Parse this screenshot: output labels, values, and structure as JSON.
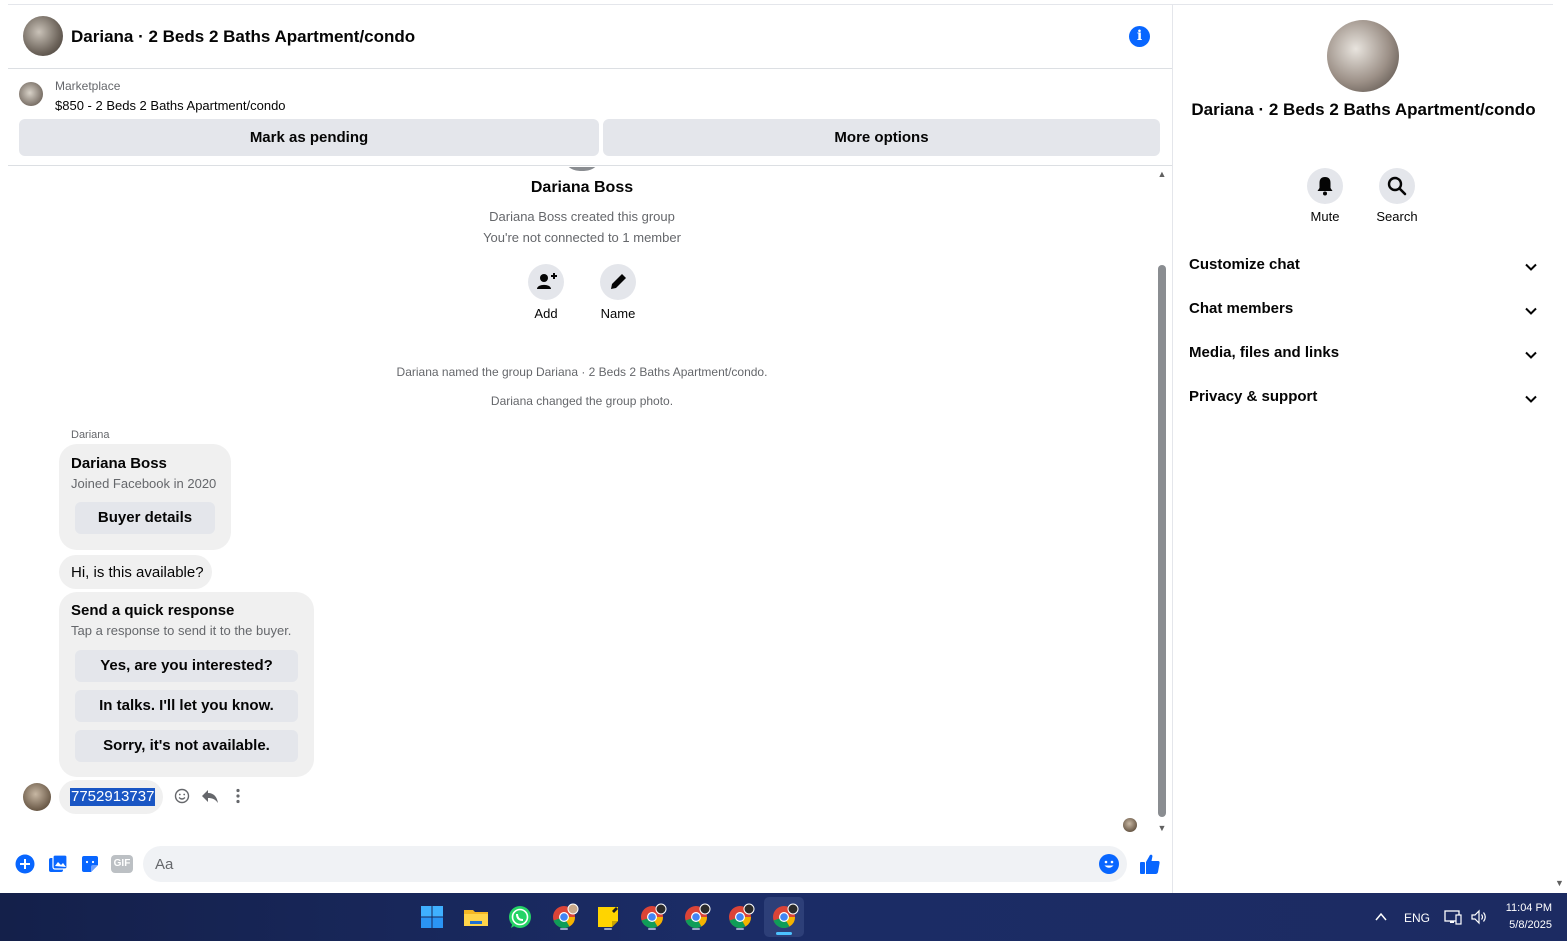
{
  "header": {
    "title": "Dariana · 2 Beds 2 Baths Apartment/condo",
    "info_icon": "info-icon"
  },
  "listing": {
    "source": "Marketplace",
    "price_title": "$850 - 2 Beds 2 Baths Apartment/condo",
    "mark_pending": "Mark as pending",
    "more_options": "More options"
  },
  "intro": {
    "creator_name": "Dariana Boss",
    "created": "Dariana Boss created this group",
    "not_connected": "You're not connected to 1 member",
    "add_label": "Add",
    "name_label": "Name"
  },
  "system_messages": [
    "Dariana named the group Dariana · 2 Beds 2 Baths Apartment/condo.",
    "Dariana changed the group photo."
  ],
  "messages": {
    "sender": "Dariana",
    "profile_card": {
      "name": "Dariana Boss",
      "joined": "Joined Facebook in 2020",
      "button": "Buyer details"
    },
    "question": "Hi, is this available?",
    "quick_response": {
      "title": "Send a quick response",
      "subtitle": "Tap a response to send it to the buyer.",
      "options": [
        "Yes, are you interested?",
        "In talks. I'll let you know.",
        "Sorry, it's not available."
      ]
    },
    "my_reply": "7752913737"
  },
  "composer": {
    "placeholder": "Aa",
    "icons": [
      "plus-icon",
      "photo-icon",
      "sticker-icon",
      "gif-icon",
      "emoji-icon",
      "like-icon"
    ],
    "gif_label": "GIF"
  },
  "side_panel": {
    "name": "Dariana · 2 Beds 2 Baths Apartment/condo",
    "mute": "Mute",
    "search": "Search",
    "sections": [
      "Customize chat",
      "Chat members",
      "Media, files and links",
      "Privacy & support"
    ]
  },
  "taskbar": {
    "apps": [
      "start",
      "file-explorer",
      "whatsapp",
      "chrome",
      "sticky-notes",
      "chrome",
      "chrome",
      "chrome",
      "chrome"
    ],
    "language": "ENG",
    "time": "11:04 PM",
    "date": "5/8/2025"
  },
  "colors": {
    "accent": "#0866ff",
    "bubble": "#f0f0f0",
    "button": "#e4e6eb",
    "secondary_text": "#65676b",
    "taskbar": "#1b2c66"
  }
}
